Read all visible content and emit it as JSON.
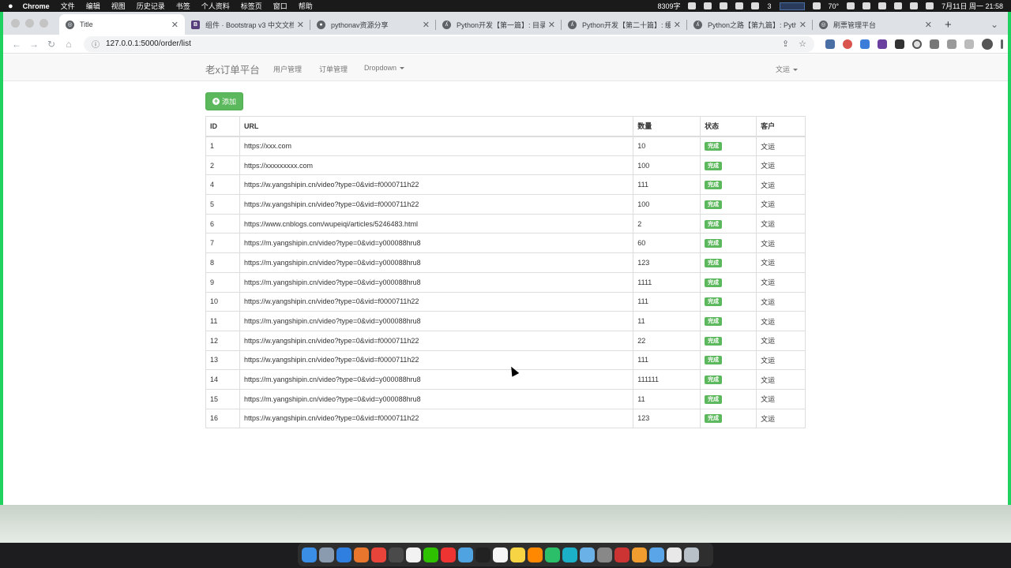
{
  "menubar": {
    "app": "Chrome",
    "items": [
      "文件",
      "编辑",
      "视图",
      "历史记录",
      "书签",
      "个人资料",
      "标签页",
      "窗口",
      "帮助"
    ],
    "word_count": "8309字",
    "wechat_count": "3",
    "temperature": "70°",
    "datetime": "7月11日 周一 21:58"
  },
  "tabs": [
    {
      "title": "Title",
      "icon": "globe-icon",
      "active": true
    },
    {
      "title": "组件 · Bootstrap v3 中文文档 |",
      "icon": "bootstrap-icon",
      "active": false
    },
    {
      "title": "pythonav资源分享",
      "icon": "github-icon",
      "active": false
    },
    {
      "title": "Python开发【第一篇】: 目录 -",
      "icon": "yuque-icon",
      "active": false
    },
    {
      "title": "Python开发【第二十篇】: 缓存",
      "icon": "yuque-icon",
      "active": false
    },
    {
      "title": "Python之路【第九篇】: Pytho",
      "icon": "yuque-icon",
      "active": false
    },
    {
      "title": "刷票管理平台",
      "icon": "globe-icon",
      "active": false
    }
  ],
  "address": "127.0.0.1:5000/order/list",
  "navbar": {
    "brand": "老x订单平台",
    "links": [
      "用户管理",
      "订单管理",
      "Dropdown"
    ],
    "user": "文运"
  },
  "add_button": "添加",
  "table": {
    "headers": [
      "ID",
      "URL",
      "数量",
      "状态",
      "客户"
    ],
    "status_label": "完成",
    "rows": [
      {
        "id": "1",
        "url": "https://xxx.com",
        "qty": "10",
        "customer": "文运"
      },
      {
        "id": "2",
        "url": "https://xxxxxxxxx.com",
        "qty": "100",
        "customer": "文运"
      },
      {
        "id": "4",
        "url": "https://w.yangshipin.cn/video?type=0&vid=f0000711h22",
        "qty": "111",
        "customer": "文运"
      },
      {
        "id": "5",
        "url": "https://w.yangshipin.cn/video?type=0&vid=f0000711h22",
        "qty": "100",
        "customer": "文运"
      },
      {
        "id": "6",
        "url": "https://www.cnblogs.com/wupeiqi/articles/5246483.html",
        "qty": "2",
        "customer": "文运"
      },
      {
        "id": "7",
        "url": "https://m.yangshipin.cn/video?type=0&vid=y000088hru8",
        "qty": "60",
        "customer": "文运"
      },
      {
        "id": "8",
        "url": "https://m.yangshipin.cn/video?type=0&vid=y000088hru8",
        "qty": "123",
        "customer": "文运"
      },
      {
        "id": "9",
        "url": "https://m.yangshipin.cn/video?type=0&vid=y000088hru8",
        "qty": "1111",
        "customer": "文运"
      },
      {
        "id": "10",
        "url": "https://w.yangshipin.cn/video?type=0&vid=f0000711h22",
        "qty": "111",
        "customer": "文运"
      },
      {
        "id": "11",
        "url": "https://m.yangshipin.cn/video?type=0&vid=y000088hru8",
        "qty": "11",
        "customer": "文运"
      },
      {
        "id": "12",
        "url": "https://w.yangshipin.cn/video?type=0&vid=f0000711h22",
        "qty": "22",
        "customer": "文运"
      },
      {
        "id": "13",
        "url": "https://w.yangshipin.cn/video?type=0&vid=f0000711h22",
        "qty": "111",
        "customer": "文运"
      },
      {
        "id": "14",
        "url": "https://m.yangshipin.cn/video?type=0&vid=y000088hru8",
        "qty": "111111",
        "customer": "文运"
      },
      {
        "id": "15",
        "url": "https://m.yangshipin.cn/video?type=0&vid=y000088hru8",
        "qty": "11",
        "customer": "文运"
      },
      {
        "id": "16",
        "url": "https://w.yangshipin.cn/video?type=0&vid=f0000711h22",
        "qty": "123",
        "customer": "文运"
      }
    ]
  },
  "colors": {
    "success": "#5cb85c",
    "navbar_bg": "#f8f8f8",
    "screen_border": "#1fd15f"
  },
  "dock_icons": [
    "finder-icon",
    "launchpad-icon",
    "safari-icon",
    "firefox-icon",
    "chrome-icon",
    "app-icon",
    "calendar-icon",
    "wechat-icon",
    "netease-music-icon",
    "preview-icon",
    "terminal-icon",
    "notes-icon",
    "stickies-icon",
    "sublime-icon",
    "pycharm-icon",
    "pycharm-ce-icon",
    "cloud-icon",
    "system-prefs-icon",
    "app-icon",
    "folder-icon",
    "folder-icon",
    "text-edit-icon",
    "trash-icon"
  ]
}
